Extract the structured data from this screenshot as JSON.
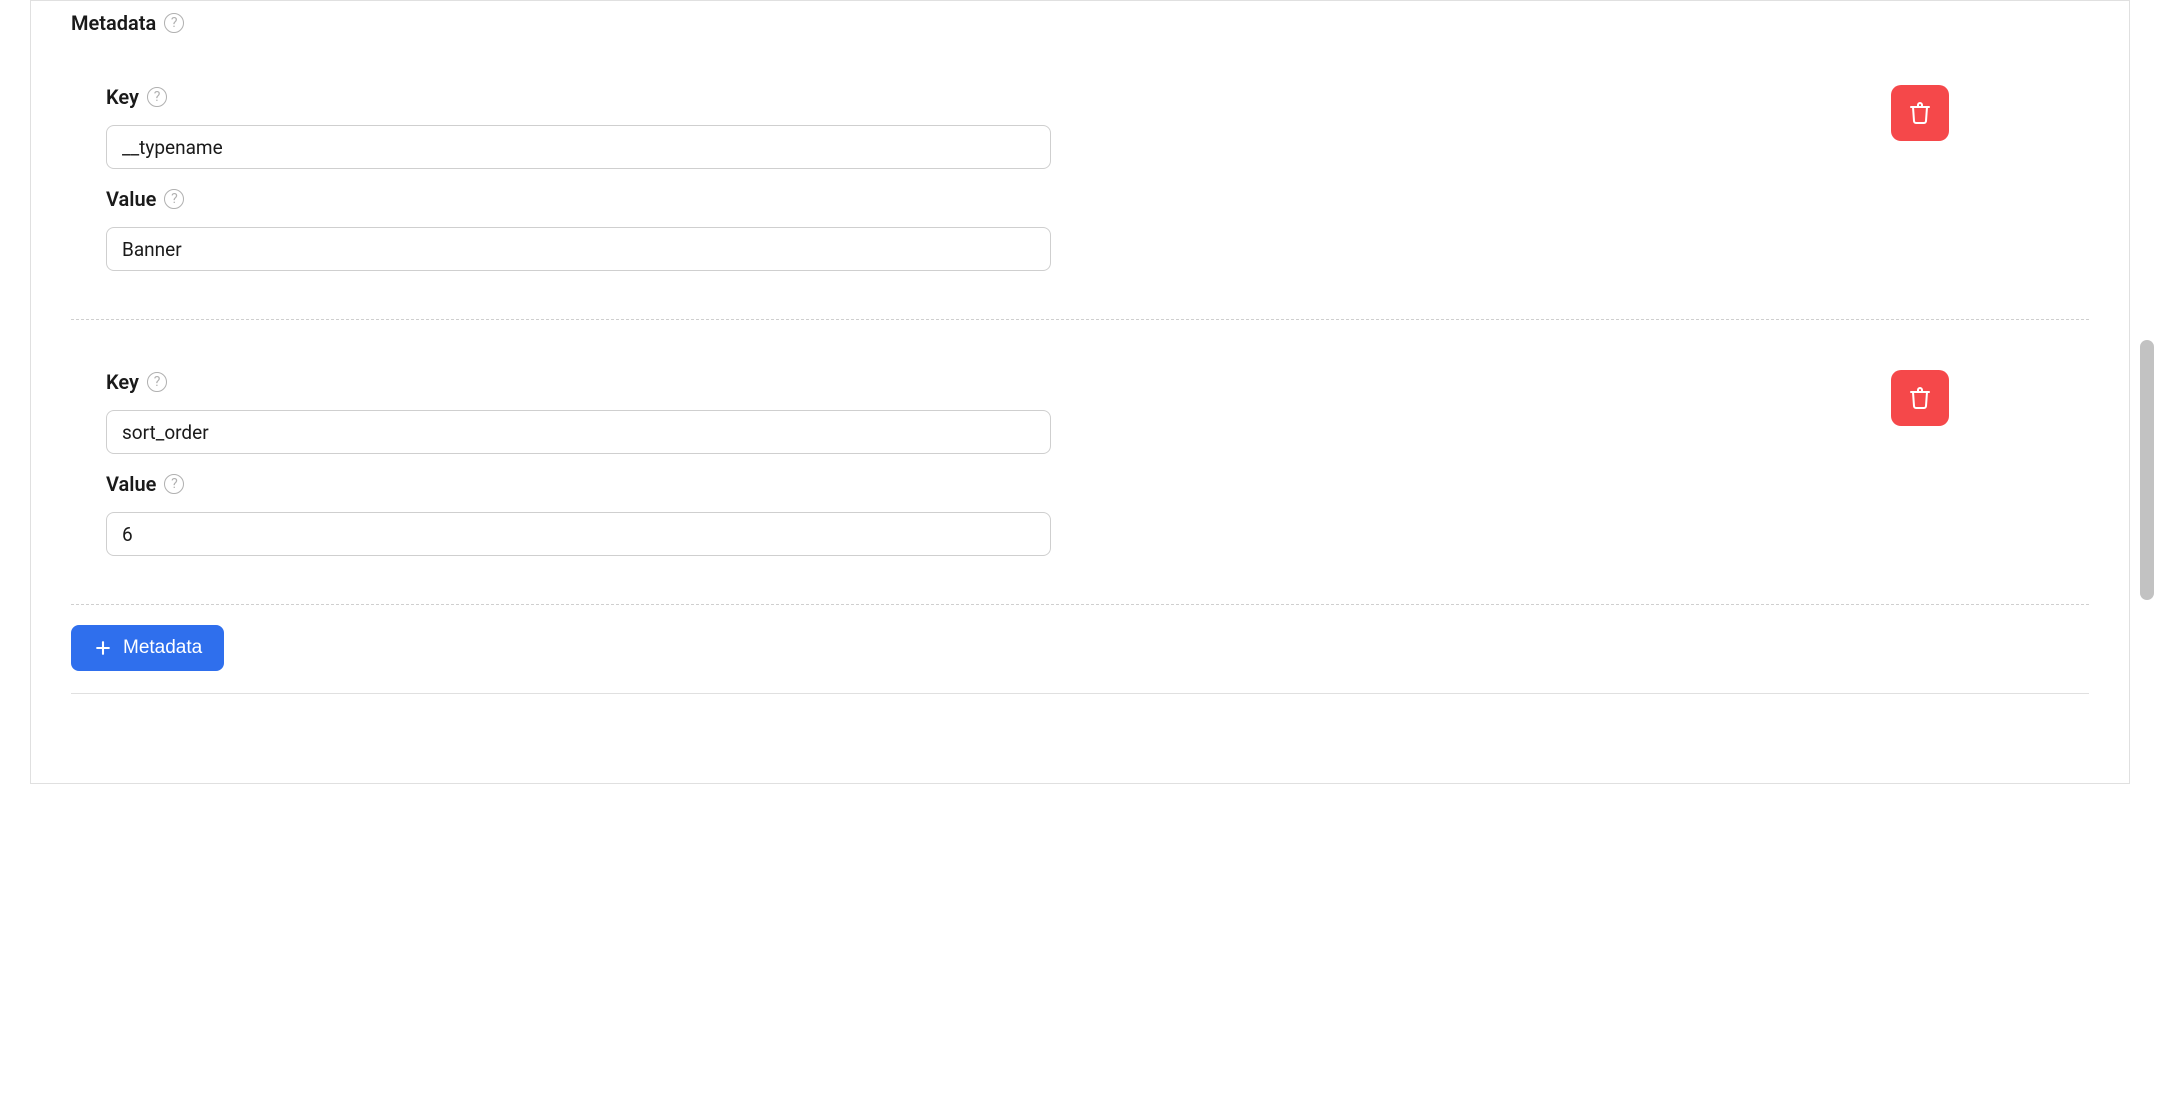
{
  "section": {
    "title": "Metadata",
    "add_button_label": "Metadata"
  },
  "labels": {
    "key": "Key",
    "value": "Value"
  },
  "items": [
    {
      "key": "__typename",
      "value": "Banner"
    },
    {
      "key": "sort_order",
      "value": "6"
    }
  ],
  "icons": {
    "help_glyph": "?"
  }
}
